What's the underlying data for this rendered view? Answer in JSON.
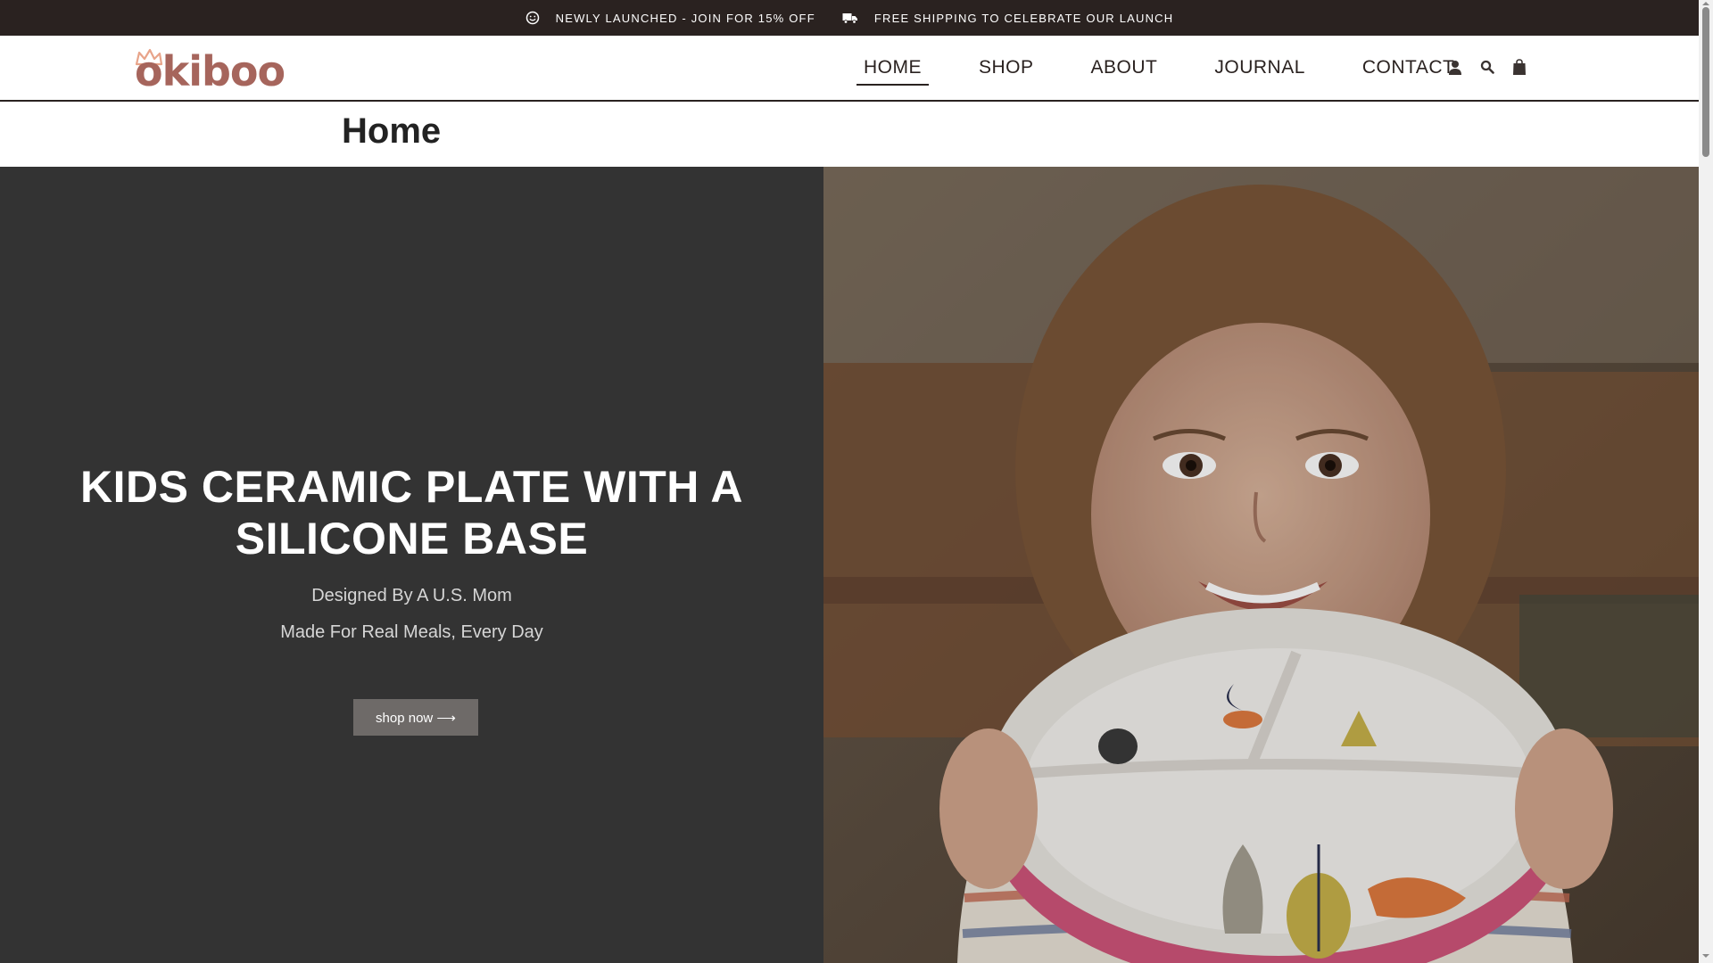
{
  "announcement": {
    "left_text": "NEWLY LAUNCHED - JOIN FOR 15% OFF",
    "left_icon": "smile-icon",
    "right_text": "FREE SHIPPING TO CELEBRATE OUR LAUNCH",
    "right_icon": "truck-icon"
  },
  "brand": {
    "logo_text": "okiboo",
    "logo_color": "#a6655c",
    "crown_color": "#e8a48a"
  },
  "nav": {
    "items": [
      {
        "label": "HOME",
        "active": true
      },
      {
        "label": "SHOP",
        "active": false
      },
      {
        "label": "ABOUT",
        "active": false
      },
      {
        "label": "JOURNAL",
        "active": false
      },
      {
        "label": "CONTACT",
        "active": false
      }
    ]
  },
  "header_icons": [
    "user-icon",
    "search-icon",
    "shopping-bag-icon"
  ],
  "page": {
    "title": "Home"
  },
  "hero": {
    "heading_line1": "KIDS CERAMIC PLATE WITH A",
    "heading_line2": "SILICONE BASE",
    "subtitle1": "Designed By A U.S. Mom",
    "subtitle2": "Made For Real Meals, Every Day",
    "cta_label": "shop now ⟶",
    "image_icon": "hero-photo-girl-holding-plate"
  },
  "colors": {
    "announcement_bg": "#2a2220",
    "hero_left_bg": "#333333",
    "button_bg": "#6e6a68",
    "text_dark": "#2a2220"
  }
}
